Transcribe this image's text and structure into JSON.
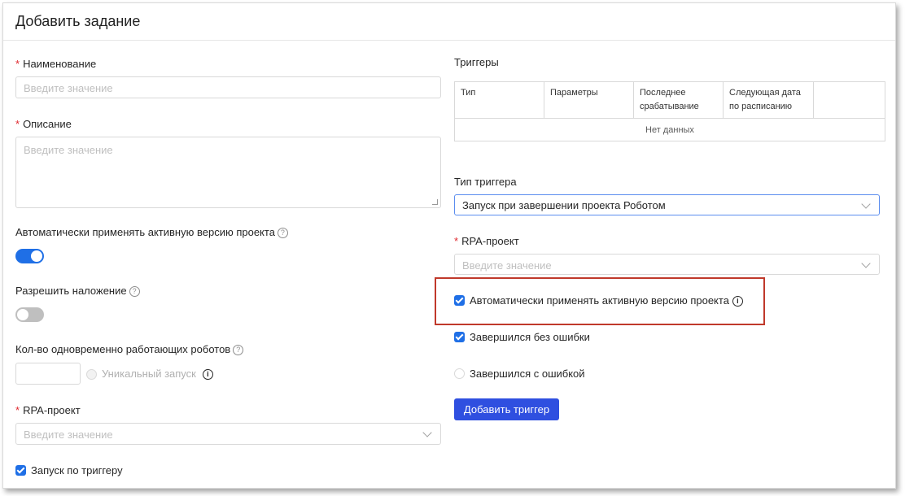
{
  "dialog": {
    "title": "Добавить задание"
  },
  "left": {
    "name": {
      "label": "Наименование",
      "placeholder": "Введите значение"
    },
    "description": {
      "label": "Описание",
      "placeholder": "Введите значение"
    },
    "auto_version": {
      "label": "Автоматически применять активную версию проекта",
      "enabled": true
    },
    "allow_overlap": {
      "label": "Разрешить наложение",
      "enabled": false
    },
    "robots_count": {
      "label": "Кол-во одновременно работающих роботов",
      "value": "",
      "unique_label": "Уникальный запуск"
    },
    "rpa_project": {
      "label": "RPA-проект",
      "placeholder": "Введите значение"
    },
    "trigger_launch": {
      "label": "Запуск по триггеру",
      "checked": true
    }
  },
  "right": {
    "triggers_title": "Триггеры",
    "table": {
      "columns": [
        "Тип",
        "Параметры",
        "Последнее срабатывание",
        "Следующая дата по расписанию",
        ""
      ],
      "empty_text": "Нет данных"
    },
    "trigger_type": {
      "label": "Тип триггера",
      "value": "Запуск при завершении проекта Роботом"
    },
    "rpa_project": {
      "label": "RPA-проект",
      "placeholder": "Введите значение"
    },
    "auto_version": {
      "label": "Автоматически применять активную версию проекта",
      "checked": true
    },
    "finished_ok": {
      "label": "Завершился без ошибки",
      "checked": true
    },
    "finished_error": {
      "label": "Завершился с ошибкой",
      "checked": false
    },
    "add_trigger_button": "Добавить триггер"
  },
  "colors": {
    "accent": "#1f6fe6",
    "button": "#2f4fe0",
    "required": "#e0282e",
    "highlight": "#c0392b"
  }
}
